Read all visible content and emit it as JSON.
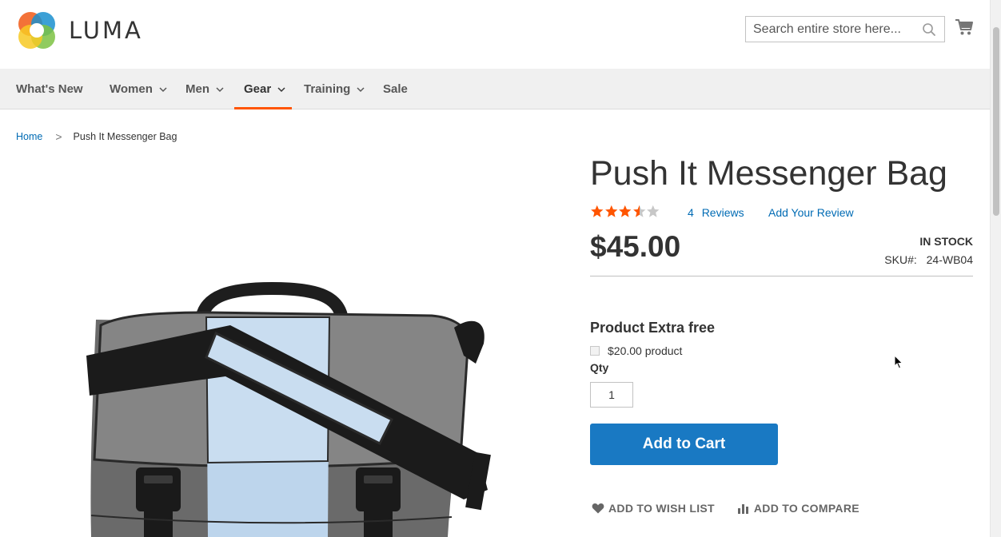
{
  "brand": {
    "name": "LUMA"
  },
  "search": {
    "placeholder": "Search entire store here..."
  },
  "icons": {
    "search": "search-icon",
    "cart": "cart-icon",
    "wishlist": "heart-icon",
    "compare": "bar-chart-icon"
  },
  "nav": {
    "items": [
      {
        "label": "What's New",
        "has_menu": false
      },
      {
        "label": "Women",
        "has_menu": true
      },
      {
        "label": "Men",
        "has_menu": true
      },
      {
        "label": "Gear",
        "has_menu": true,
        "active": true
      },
      {
        "label": "Training",
        "has_menu": true
      },
      {
        "label": "Sale",
        "has_menu": false
      }
    ]
  },
  "breadcrumb": {
    "home": "Home",
    "separator": ">",
    "current": "Push It Messenger Bag"
  },
  "product": {
    "title": "Push It Messenger Bag",
    "rating_stars": 3.5,
    "rating_max": 5,
    "reviews_count": "4",
    "reviews_label": "Reviews",
    "add_review": "Add Your Review",
    "price": "$45.00",
    "stock": "IN STOCK",
    "sku_label": "SKU#:",
    "sku": "24-WB04",
    "extra_title": "Product Extra free",
    "extra_option": "$20.00 product",
    "qty_label": "Qty",
    "qty_value": "1",
    "add_to_cart": "Add to Cart",
    "wishlist": "ADD TO WISH LIST",
    "compare": "ADD TO COMPARE"
  },
  "colors": {
    "accent": "#ff5501",
    "link": "#006bb4",
    "button": "#1979c3",
    "star": "#ff5501",
    "star_empty": "#c7c7c7"
  }
}
